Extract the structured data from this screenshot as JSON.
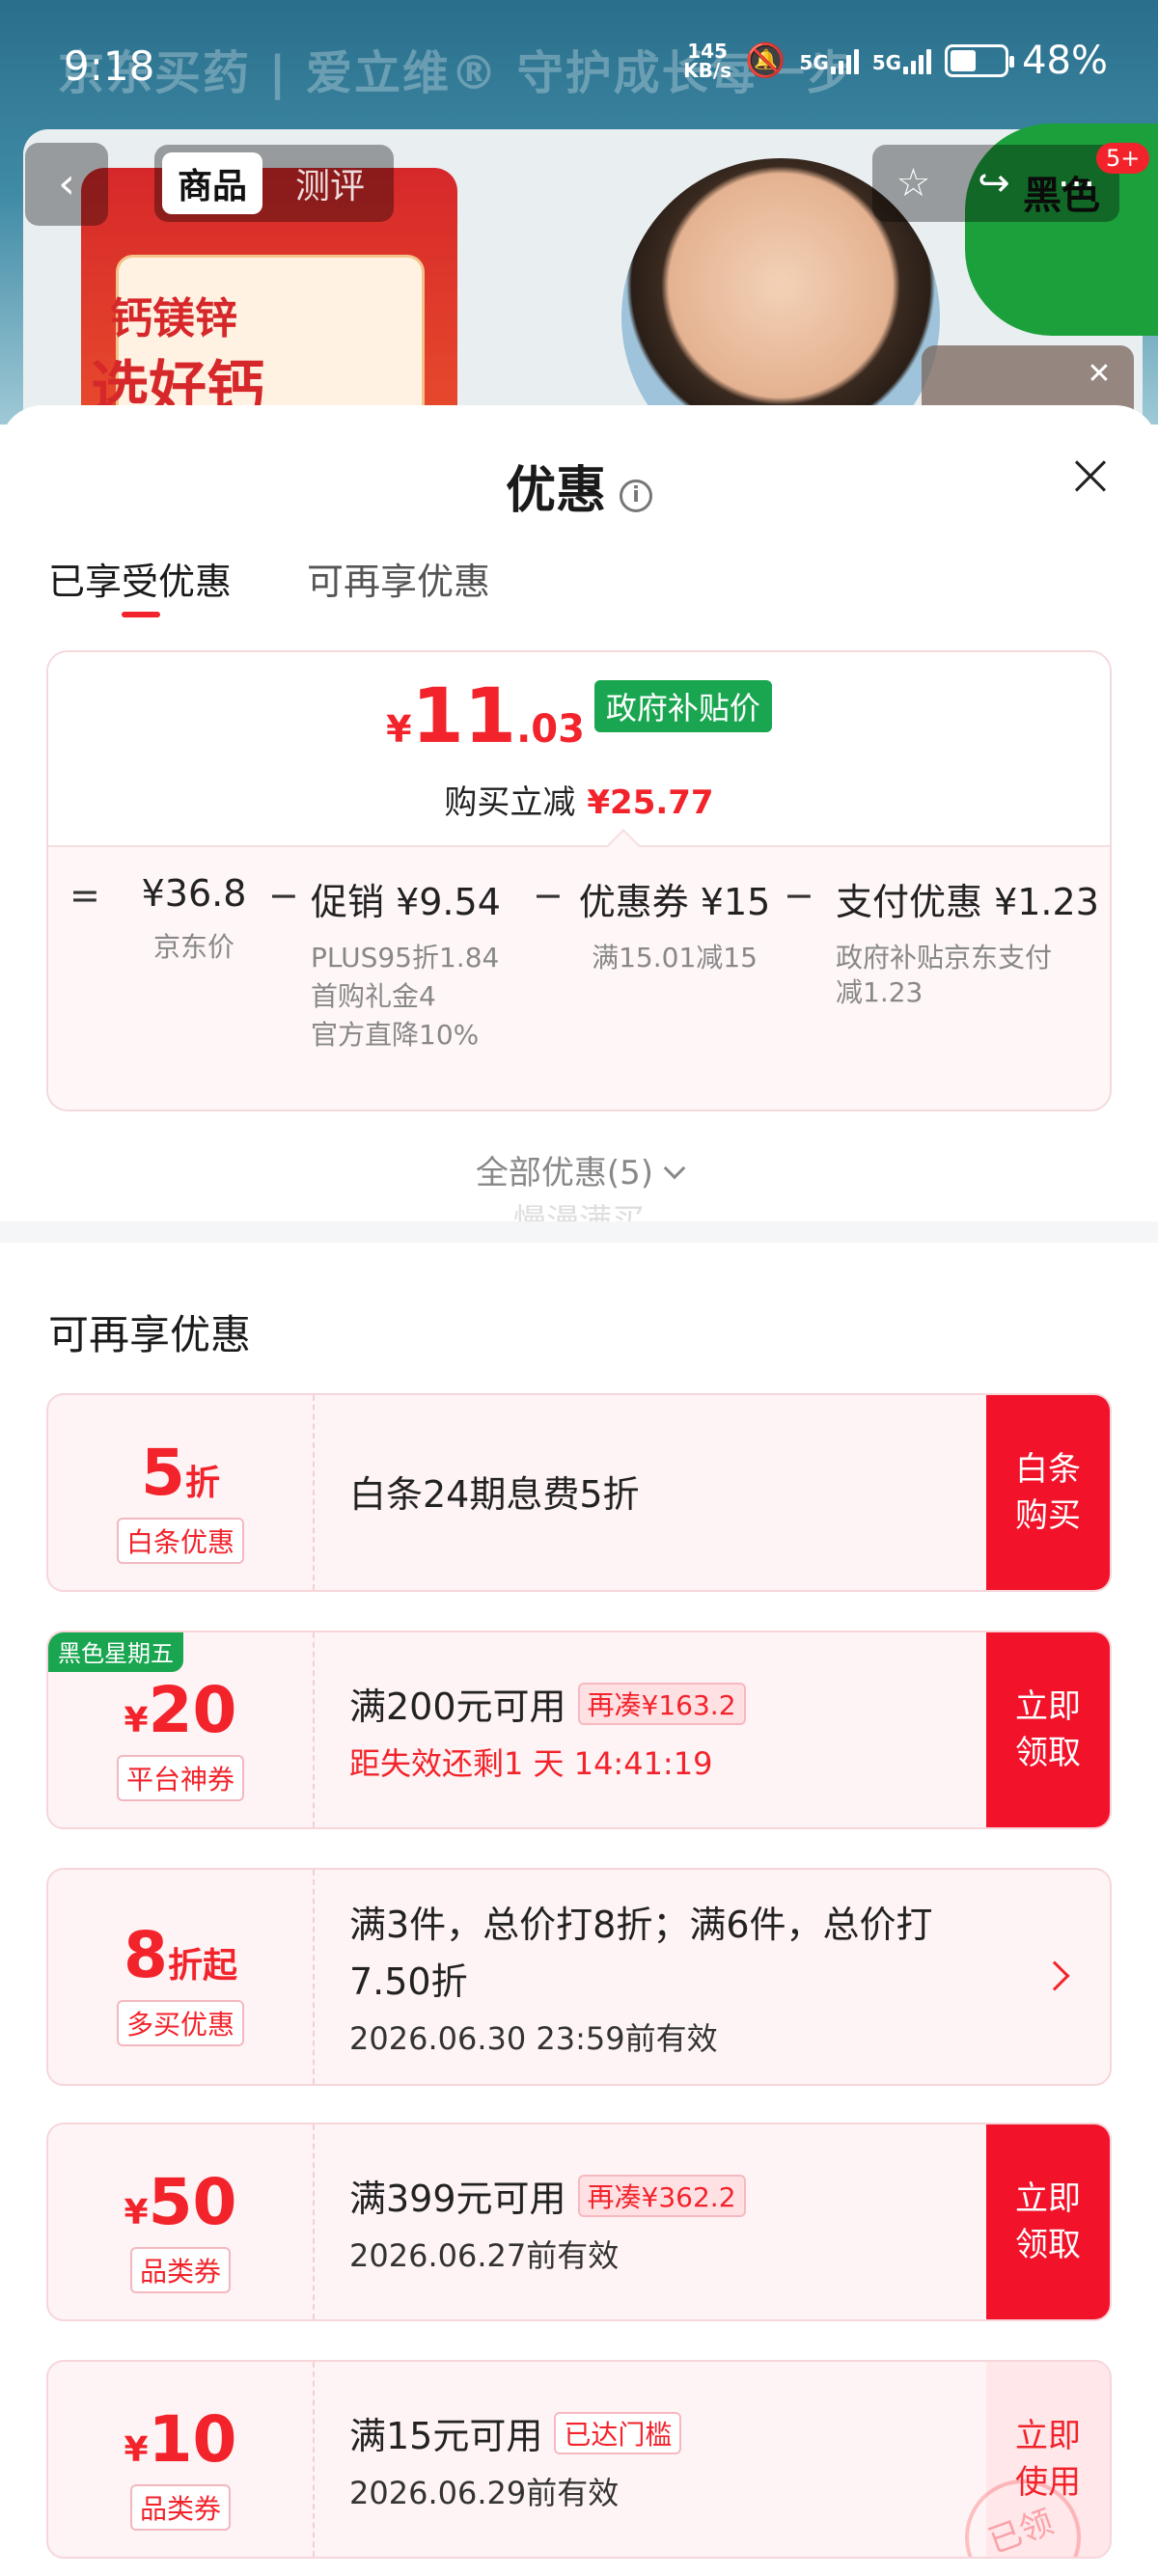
{
  "status_bar": {
    "time": "9:18",
    "speed_value": "145",
    "speed_unit": "KB/s",
    "signal1_label": "5G",
    "signal2_label": "5G",
    "battery_percent": 48,
    "battery_text": "48%"
  },
  "background": {
    "banner_text": "京东买药 | 爱立维®  守护成长每一步",
    "promo_line1": "钙镁锌",
    "promo_line2": "选好钙",
    "badge_text": "黑色"
  },
  "nav": {
    "tabs": [
      {
        "label": "商品"
      },
      {
        "label": "测评"
      }
    ],
    "badge": "5+"
  },
  "sheet": {
    "title": "优惠",
    "tabs": [
      {
        "label": "已享受优惠"
      },
      {
        "label": "可再享优惠"
      }
    ]
  },
  "summary": {
    "currency": "¥",
    "price_int": "11",
    "price_dec": ".03",
    "gov_tag": "政府补贴价",
    "reduce_label": "购买立减",
    "reduce_amount": "¥25.77",
    "breakdown": [
      {
        "op": "=",
        "head": "¥36.8",
        "subs": [
          "京东价"
        ]
      },
      {
        "op": "−",
        "head": "促销 ¥9.54",
        "subs": [
          "PLUS95折1.84",
          "首购礼金4",
          "官方直降10%"
        ]
      },
      {
        "op": "−",
        "head": "优惠券 ¥15",
        "subs": [
          "满15.01减15"
        ]
      },
      {
        "op": "−",
        "head": "支付优惠 ¥1.23",
        "subs": [
          "政府补贴京东支付",
          "减1.23"
        ]
      }
    ]
  },
  "all_discount_label": "全部优惠(5)",
  "watermark": "慢漫满买",
  "section_title": "可再享优惠",
  "coupons": [
    {
      "value": "5",
      "unit": "折",
      "tag": "白条优惠",
      "line1": "白条24期息费5折",
      "button": "白条购买"
    },
    {
      "corner": "黑色星期五",
      "prefix": "¥",
      "value": "20",
      "tag": "平台神券",
      "line1": "满200元可用",
      "pill": "再凑¥163.2",
      "line2": "距失效还剩1 天 14:41:19",
      "button": "立即领取"
    },
    {
      "value": "8",
      "unit": "折起",
      "tag": "多买优惠",
      "line1": "满3件，总价打8折；满6件，总价打",
      "line1b": "7.50折",
      "line2": "2026.06.30 23:59前有效"
    },
    {
      "prefix": "¥",
      "value": "50",
      "tag": "品类券",
      "line1": "满399元可用",
      "pill": "再凑¥362.2",
      "line2": "2026.06.27前有效",
      "button": "立即领取"
    },
    {
      "prefix": "¥",
      "value": "10",
      "tag": "品类券",
      "line1": "满15元可用",
      "pill": "已达门槛",
      "line2": "2026.06.29前有效",
      "button": "立即使用",
      "stamp": "已领"
    }
  ],
  "colors": {
    "accent_red": "#f2232b",
    "gov_green": "#1aa650",
    "card_bg": "#fff4f5"
  }
}
